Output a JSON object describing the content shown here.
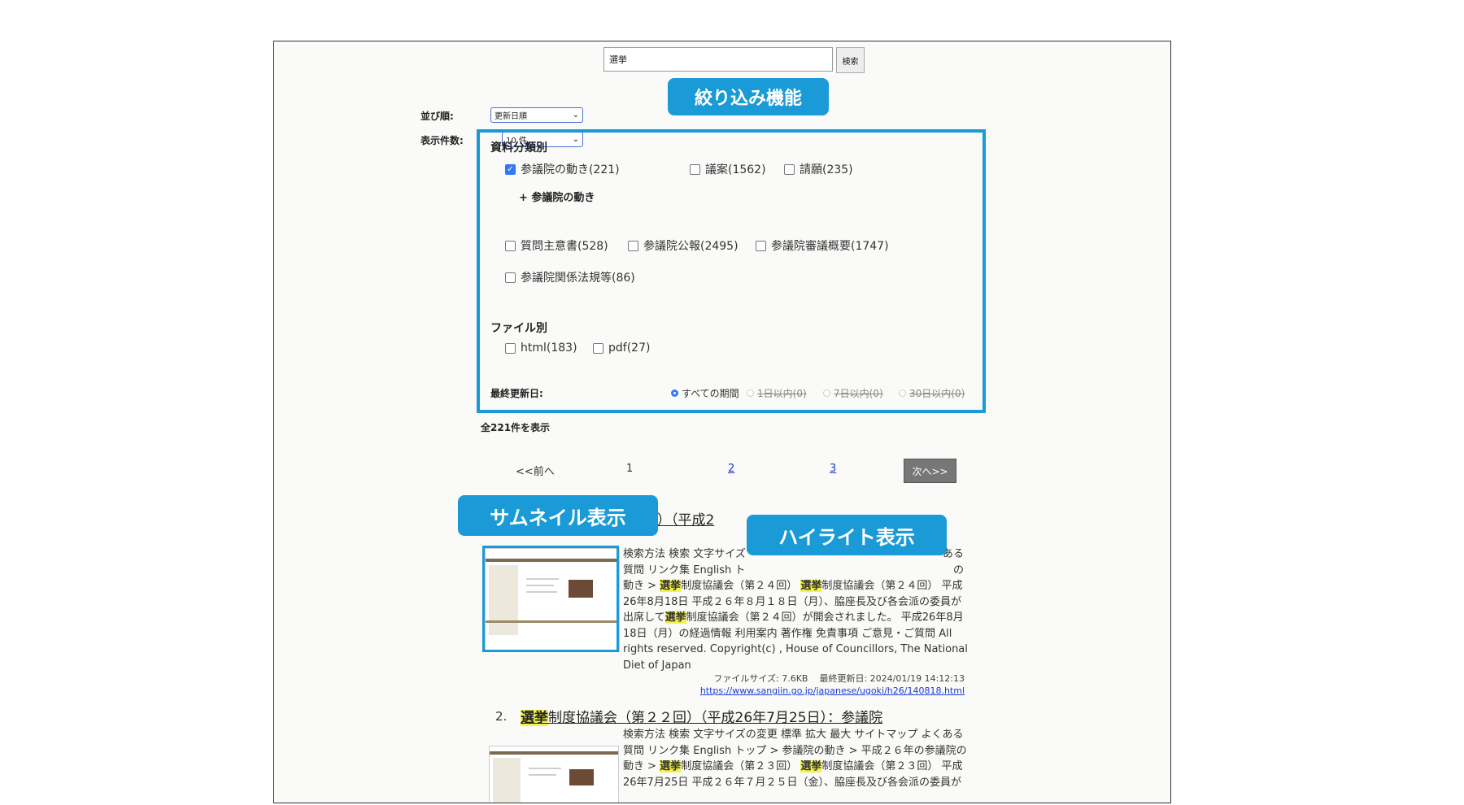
{
  "search": {
    "value": "選挙",
    "button_label": "検索"
  },
  "sort": {
    "label": "並び順:",
    "value": "更新日順"
  },
  "count": {
    "label": "表示件数:",
    "value": "10 件"
  },
  "callouts": {
    "filter": "絞り込み機能",
    "thumbnail": "サムネイル表示",
    "highlight": "ハイライト表示"
  },
  "filters": {
    "category_title": "資料分類別",
    "categories": [
      {
        "label": "参議院の動き(221)",
        "checked": true
      },
      {
        "label": "議案(1562)",
        "checked": false
      },
      {
        "label": "請願(235)",
        "checked": false
      },
      {
        "label": "質問主意書(528)",
        "checked": false
      },
      {
        "label": "参議院公報(2495)",
        "checked": false
      },
      {
        "label": "参議院審議概要(1747)",
        "checked": false
      },
      {
        "label": "参議院関係法規等(86)",
        "checked": false
      }
    ],
    "subcategory": "+ 参議院の動き",
    "file_title": "ファイル別",
    "files": [
      {
        "label": "html(183)",
        "checked": false
      },
      {
        "label": "pdf(27)",
        "checked": false
      }
    ],
    "date_title": "最終更新日:",
    "date_options": [
      {
        "label": "すべての期間",
        "selected": true
      },
      {
        "label": "1日以内(0)",
        "selected": false
      },
      {
        "label": "7日以内(0)",
        "selected": false
      },
      {
        "label": "30日以内(0)",
        "selected": false
      }
    ]
  },
  "total": "全221件を表示",
  "pagination": {
    "prev": "<<前へ",
    "pages": [
      "1",
      "2",
      "3"
    ],
    "current": "1",
    "next": "次へ>>"
  },
  "results": [
    {
      "title_visible": "４回）（平成2",
      "snippet_lines": [
        "検索方法 検索 文字サイズ",
        "質問 リンク集 English ト",
        "動き > ",
        "26年8月18日 平成２６年８月１８日（月）、脇座長及び各会派の委員が",
        "出席して",
        "18日（月）の経過情報 利用案内 著作権 免責事項 ご意見・ご質問 All",
        "rights reserved. Copyright(c) , House of Councillors, The National",
        "Diet of Japan"
      ],
      "snippet_fragments": {
        "line0_tail": "ある",
        "line1_tail": "の",
        "line2_a": "制度協議会（第２４回）",
        "line2_b": "制度協議会（第２４回） 平成",
        "line4_a": "制度協議会（第２４回）が開会されました。 平成26年8月"
      },
      "keyword": "選挙",
      "file_size": "ファイルサイズ: 7.6KB",
      "updated": "最終更新日: 2024/01/19 14:12:13",
      "url": "https://www.sangiin.go.jp/japanese/ugoki/h26/140818.html"
    },
    {
      "number": "2.",
      "title_rest": "制度協議会（第２２回）（平成26年7月25日）：参議院",
      "snippet_lines": [
        "検索方法 検索 文字サイズの変更 標準 拡大 最大 サイトマップ よくある",
        "質問 リンク集 English トップ > 参議院の動き > 平成２６年の参議院の",
        "動き > ",
        "26年7月25日 平成２６年７月２５日（金）、脇座長及び各会派の委員が"
      ],
      "snippet_fragments": {
        "line2_a": "制度協議会（第２３回）",
        "line2_b": "制度協議会（第２３回） 平成"
      },
      "keyword": "選挙"
    }
  ]
}
